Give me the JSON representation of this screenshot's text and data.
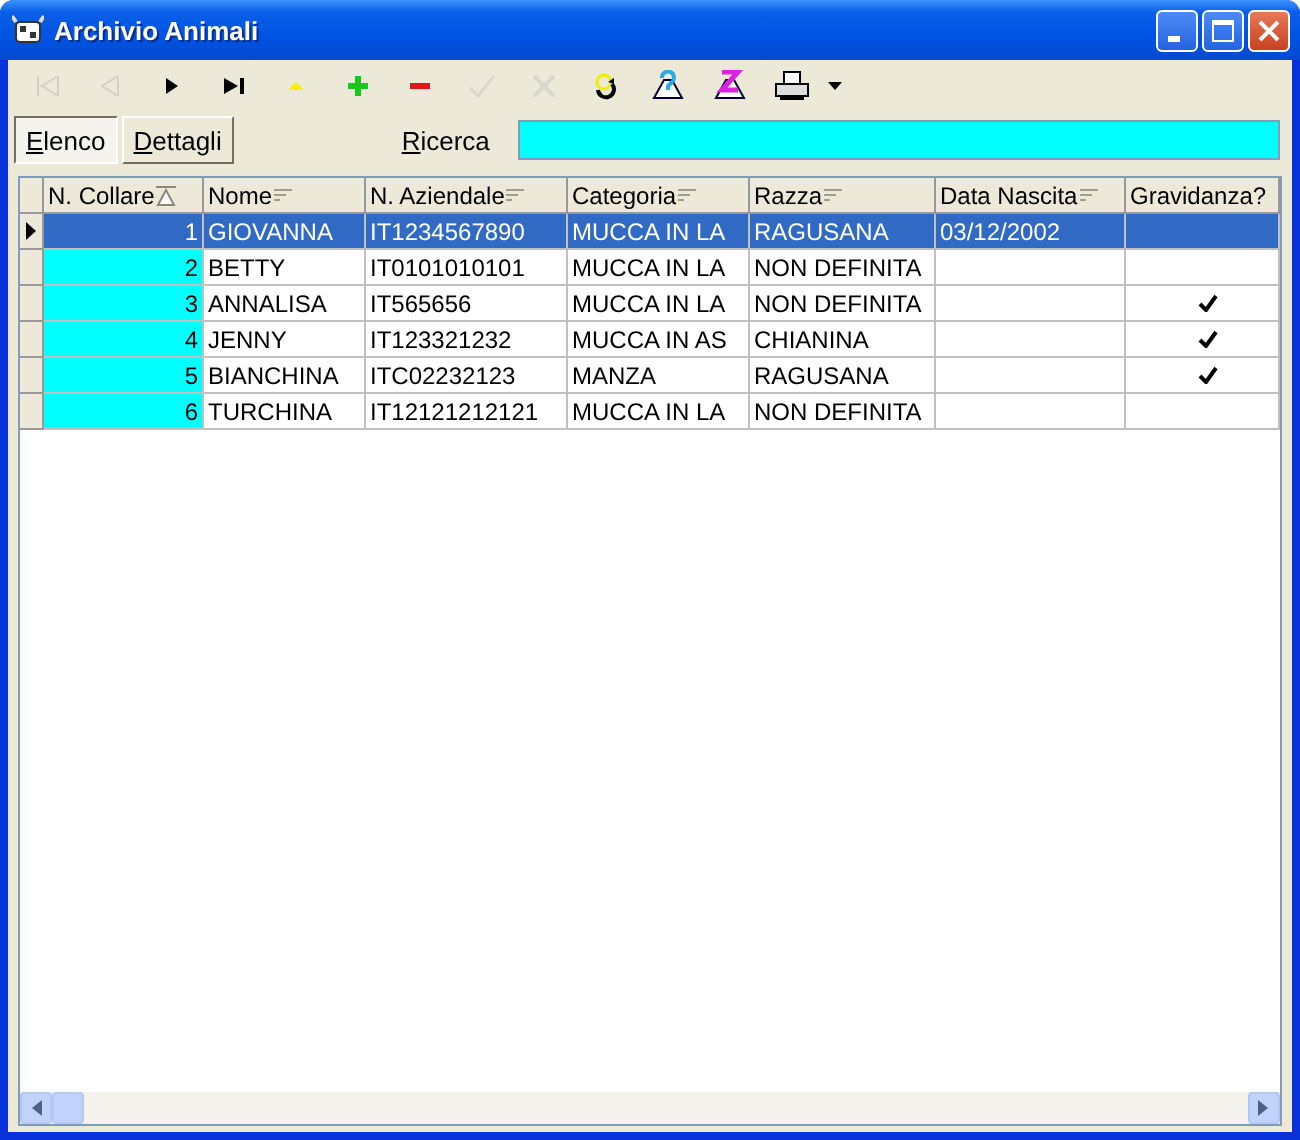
{
  "window": {
    "title": "Archivio Animali"
  },
  "toolbar": [
    {
      "kind": "first",
      "disabled": true
    },
    {
      "kind": "prev",
      "disabled": true
    },
    {
      "kind": "next",
      "disabled": false
    },
    {
      "kind": "last",
      "disabled": false
    },
    {
      "kind": "edit",
      "disabled": false
    },
    {
      "kind": "add",
      "disabled": false
    },
    {
      "kind": "delete",
      "disabled": false
    },
    {
      "kind": "confirm",
      "disabled": true
    },
    {
      "kind": "cancel",
      "disabled": true
    },
    {
      "kind": "refresh",
      "disabled": false
    },
    {
      "kind": "find",
      "disabled": false
    },
    {
      "kind": "filter",
      "disabled": false
    },
    {
      "kind": "print",
      "disabled": false
    },
    {
      "kind": "dropdown",
      "disabled": false
    }
  ],
  "tabs": [
    {
      "label": "Elenco",
      "selected": true
    },
    {
      "label": "Dettagli",
      "selected": false
    }
  ],
  "search": {
    "label": "Ricerca"
  },
  "table": {
    "columns": [
      {
        "label": "N. Collare",
        "sortable": true,
        "sorted": true
      },
      {
        "label": "Nome",
        "sortable": true,
        "sorted": false
      },
      {
        "label": "N. Aziendale",
        "sortable": true,
        "sorted": false
      },
      {
        "label": "Categoria",
        "sortable": true,
        "sorted": false
      },
      {
        "label": "Razza",
        "sortable": true,
        "sorted": false
      },
      {
        "label": "Data Nascita",
        "sortable": true,
        "sorted": false
      },
      {
        "label": "Gravidanza?",
        "sortable": false
      }
    ],
    "rows": [
      {
        "selected": true,
        "cells": [
          "1",
          "GIOVANNA",
          "IT1234567890",
          "MUCCA IN LA",
          "RAGUSANA",
          "03/12/2002"
        ],
        "pregnant": false
      },
      {
        "selected": false,
        "cells": [
          "2",
          "BETTY",
          "IT0101010101",
          "MUCCA IN LA",
          "NON DEFINITA",
          ""
        ],
        "pregnant": false
      },
      {
        "selected": false,
        "cells": [
          "3",
          "ANNALISA",
          "IT565656",
          "MUCCA IN LA",
          "NON DEFINITA",
          ""
        ],
        "pregnant": true
      },
      {
        "selected": false,
        "cells": [
          "4",
          "JENNY",
          "IT123321232",
          "MUCCA IN AS",
          "CHIANINA",
          ""
        ],
        "pregnant": true
      },
      {
        "selected": false,
        "cells": [
          "5",
          "BIANCHINA",
          "ITC02232123",
          "MANZA",
          "RAGUSANA",
          ""
        ],
        "pregnant": true
      },
      {
        "selected": false,
        "cells": [
          "6",
          "TURCHINA",
          "IT12121212121",
          "MUCCA IN LA",
          "NON DEFINITA",
          ""
        ],
        "pregnant": false
      }
    ]
  }
}
